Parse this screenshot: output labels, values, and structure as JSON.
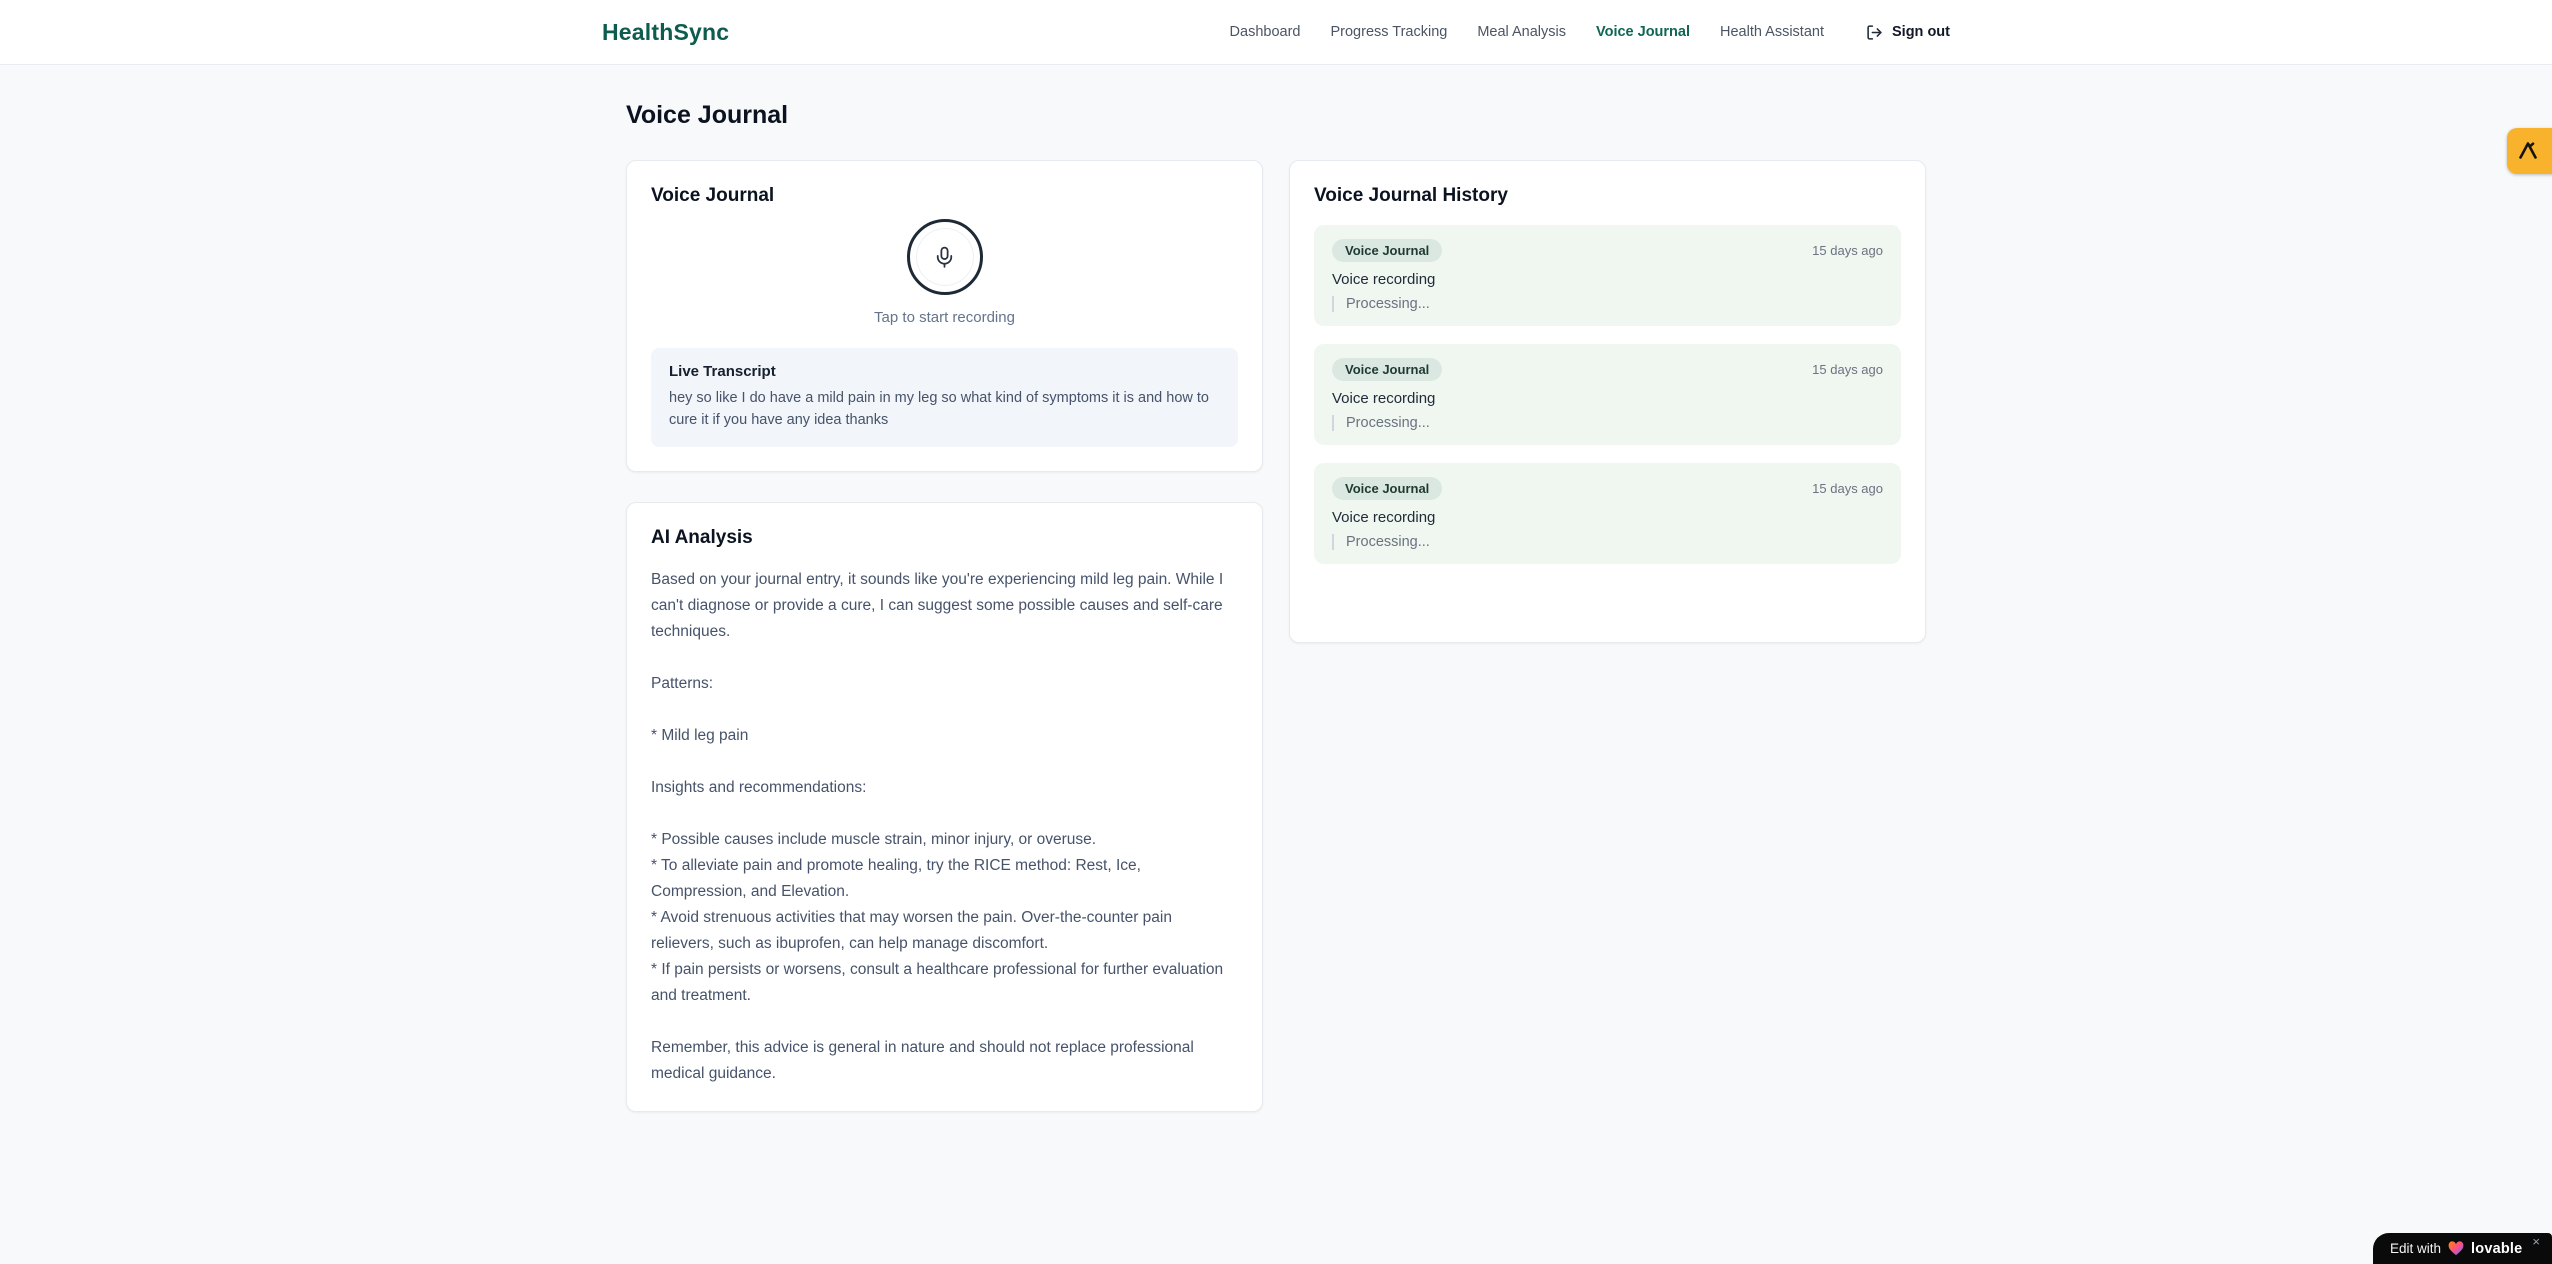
{
  "app": {
    "name": "HealthSync"
  },
  "nav": {
    "items": [
      {
        "label": "Dashboard",
        "active": false
      },
      {
        "label": "Progress Tracking",
        "active": false
      },
      {
        "label": "Meal Analysis",
        "active": false
      },
      {
        "label": "Voice Journal",
        "active": true
      },
      {
        "label": "Health Assistant",
        "active": false
      }
    ],
    "sign_out_label": "Sign out"
  },
  "page": {
    "title": "Voice Journal"
  },
  "recorder_card": {
    "title": "Voice Journal",
    "mic_icon": "microphone-icon",
    "hint": "Tap to start recording",
    "transcript_title": "Live Transcript",
    "transcript_text": "hey so like I do have a mild pain in my leg so what kind of symptoms it is and how to cure it if you have any idea thanks"
  },
  "analysis_card": {
    "title": "AI Analysis",
    "body": "Based on your journal entry, it sounds like you're experiencing mild leg pain. While I can't diagnose or provide a cure, I can suggest some possible causes and self-care techniques.\n\nPatterns:\n\n* Mild leg pain\n\nInsights and recommendations:\n\n* Possible causes include muscle strain, minor injury, or overuse.\n* To alleviate pain and promote healing, try the RICE method: Rest, Ice, Compression, and Elevation.\n* Avoid strenuous activities that may worsen the pain. Over-the-counter pain relievers, such as ibuprofen, can help manage discomfort.\n* If pain persists or worsens, consult a healthcare professional for further evaluation and treatment.\n\nRemember, this advice is general in nature and should not replace professional medical guidance."
  },
  "history_card": {
    "title": "Voice Journal History",
    "items": [
      {
        "badge": "Voice Journal",
        "time": "15 days ago",
        "label": "Voice recording",
        "status": "Processing..."
      },
      {
        "badge": "Voice Journal",
        "time": "15 days ago",
        "label": "Voice recording",
        "status": "Processing..."
      },
      {
        "badge": "Voice Journal",
        "time": "15 days ago",
        "label": "Voice recording",
        "status": "Processing..."
      }
    ]
  },
  "overlays": {
    "lovable_prefix": "Edit with",
    "lovable_brand": "lovable",
    "lovable_close": "×"
  },
  "colors": {
    "brand_teal": "#0d5c4d",
    "nav_active": "#0f6652",
    "page_bg": "#f7f9fb",
    "history_item_bg": "#eff7f0",
    "badge_bg": "#dbe8e1",
    "amber_badge": "#f9b22b",
    "lovable_bg": "#0a0a0a"
  }
}
